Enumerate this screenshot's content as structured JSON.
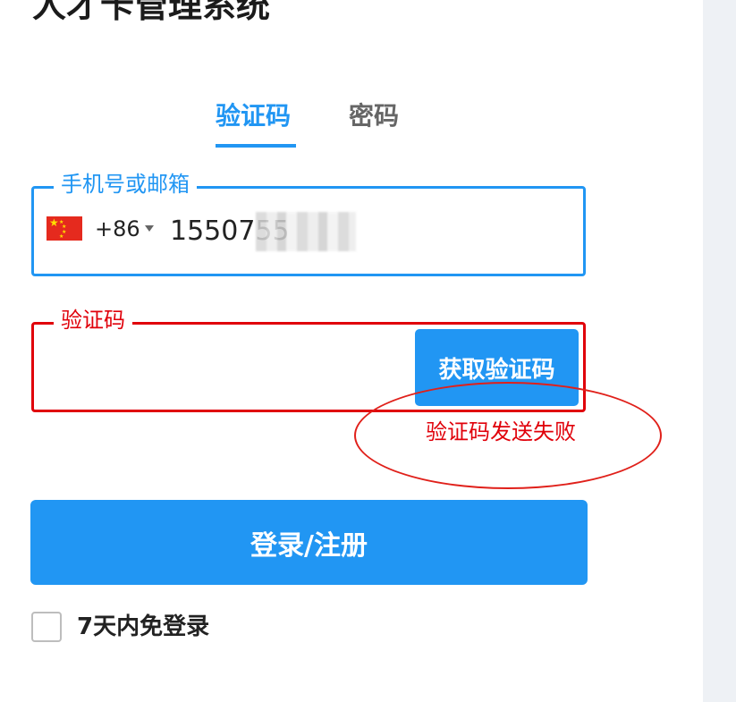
{
  "title": "人才卡管理系统",
  "tabs": [
    {
      "label": "验证码",
      "active": true
    },
    {
      "label": "密码",
      "active": false
    }
  ],
  "phone_field": {
    "legend": "手机号或邮箱",
    "country_flag": "china-flag-icon",
    "country_code": "+86",
    "value": "1550755"
  },
  "code_field": {
    "legend": "验证码",
    "value": "",
    "get_code_label": "获取验证码",
    "error": "验证码发送失败"
  },
  "login_button": "登录/注册",
  "remember": {
    "label": "7天内免登录",
    "checked": false
  },
  "colors": {
    "accent": "#2196f3",
    "error": "#e0000a"
  }
}
